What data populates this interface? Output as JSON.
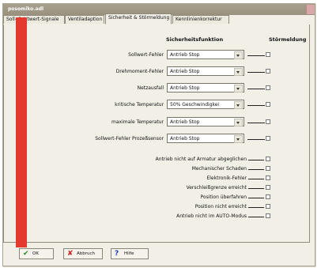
{
  "window": {
    "title": "posomiko.adl"
  },
  "tabs": [
    {
      "label": "Soll- & Istwert-Signale"
    },
    {
      "label": "Ventiladaption"
    },
    {
      "label": "Sicherheit & Störmeldung"
    },
    {
      "label": "Kennlinienkorrektur"
    }
  ],
  "headers": {
    "safety": "Sicherheitsfunktion",
    "fault": "Störmeldung"
  },
  "dropdown_rows": [
    {
      "label": "Sollwert-Fehler",
      "value": "Antrieb Stop"
    },
    {
      "label": "Drehmoment-Fehler",
      "value": "Antrieb Stop"
    },
    {
      "label": "Netzausfall",
      "value": "Antrieb Stop"
    },
    {
      "label": "kritische Temperatur",
      "value": "50% Geschwindigkei"
    },
    {
      "label": "maximale Temperatur",
      "value": "Antrieb Stop"
    },
    {
      "label": "Sollwert-Fehler Prozeßsensor",
      "value": "Antrieb Stop"
    }
  ],
  "fault_rows": [
    {
      "label": "Antrieb nicht auf Armatur abgeglichen"
    },
    {
      "label": "Mechanischer Schaden"
    },
    {
      "label": "Elektronik-Fehler"
    },
    {
      "label": "Verschleißgrenze erreicht"
    },
    {
      "label": "Position überfahren"
    },
    {
      "label": "Position nicht erreicht"
    },
    {
      "label": "Antrieb nicht im AUTO-Modus"
    }
  ],
  "buttons": {
    "ok": {
      "label": "OK",
      "icon": "check-icon"
    },
    "cancel": {
      "label": "Abbruch",
      "icon": "x-icon"
    },
    "help": {
      "label": "Hilfe",
      "icon": "question-icon"
    }
  },
  "colors": {
    "accent_bar": "#e23a2f",
    "ok_icon": "#2a8a2a",
    "cancel_icon": "#cc1a1a",
    "help_icon": "#1a3fbf"
  }
}
